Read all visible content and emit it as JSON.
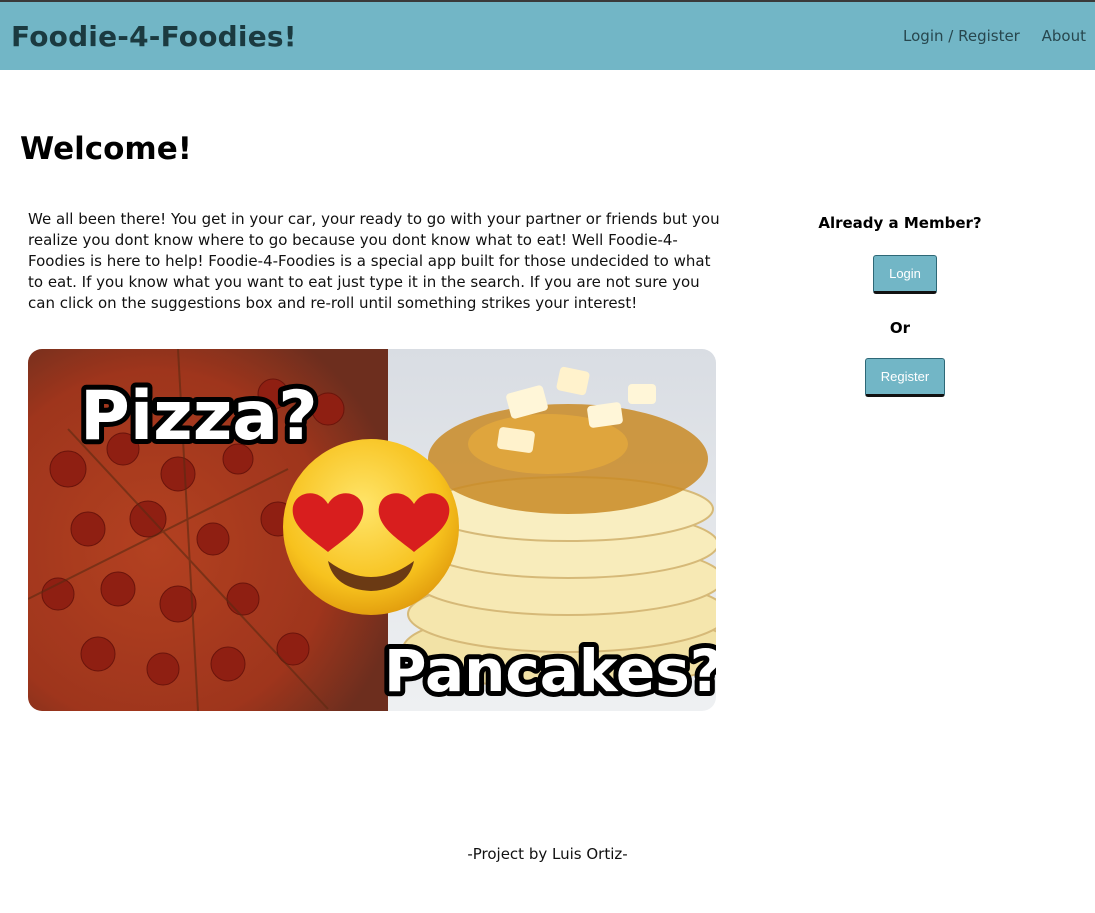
{
  "header": {
    "brand": "Foodie-4-Foodies!",
    "nav": {
      "login_register": "Login / Register",
      "about": "About"
    }
  },
  "main": {
    "title": "Welcome!",
    "intro": "We all been there! You get in your car, your ready to go with your partner or friends but you realize you dont know where to go because you dont know what to eat! Well Foodie-4-Foodies is here to help! Foodie-4-Foodies is a special app built for those undecided to what to eat. If you know what you want to eat just type it in the search. If you are not sure you can click on the suggestions box and re-roll until something strikes your interest!",
    "hero": {
      "top_text": "Pizza?",
      "bottom_text": "Pancakes?"
    }
  },
  "sidebar": {
    "heading": "Already a Member?",
    "login_label": "Login",
    "or_label": "Or",
    "register_label": "Register"
  },
  "footer": {
    "credit": "-Project by Luis Ortiz-"
  },
  "colors": {
    "navbar": "#72b6c6",
    "brand_text": "#1b3a40",
    "button": "#72b6c6"
  }
}
